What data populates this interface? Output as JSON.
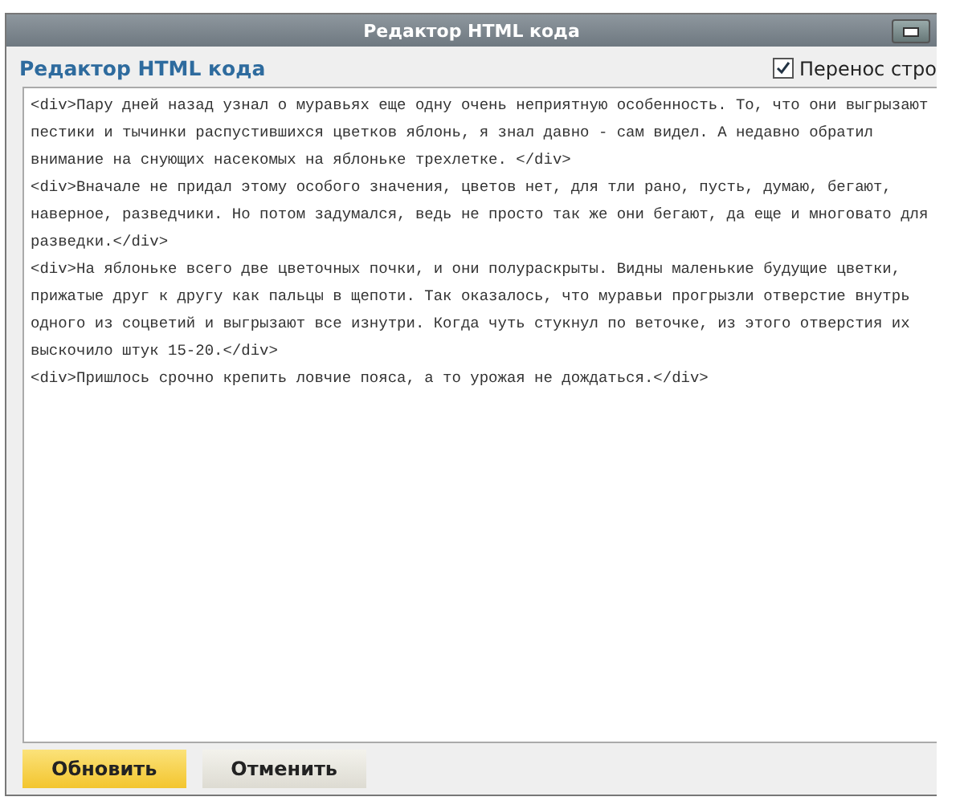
{
  "window": {
    "title": "Редактор HTML кода"
  },
  "editor": {
    "heading": "Редактор HTML кода",
    "word_wrap": {
      "label": "Перенос стро",
      "checked": true
    },
    "lines": [
      "<div>Пару дней назад узнал о муравьях еще одну очень неприятную особенность. То, что они выгрызают",
      "пестики и тычинки распустившихся цветков яблонь, я знал давно - сам видел. А недавно обратил",
      "внимание на снующих насекомых на яблоньке трехлетке. </div>",
      "<div>Вначале не придал этому особого значения, цветов нет, для тли рано, пусть, думаю, бегают,",
      "наверное, разведчики. Но потом задумался, ведь не просто так же они бегают, да еще и многовато для",
      "разведки.</div>",
      "<div>На яблоньке всего две цветочных почки, и они полураскрыты. Видны маленькие будущие цветки,",
      "прижатые друг к другу как пальцы в щепоти. Так оказалось, что муравьи прогрызли отверстие внутрь",
      "одного из соцветий и выгрызают все изнутри. Когда чуть стукнул по веточке, из этого отверстия их",
      "выскочило штук 15-20.</div>",
      "<div>Пришлось срочно крепить ловчие пояса, а то урожая не дождаться.</div>"
    ]
  },
  "buttons": [
    {
      "label": "Обновить",
      "kind": "primary"
    },
    {
      "label": "Отменить",
      "kind": "secondary"
    }
  ]
}
